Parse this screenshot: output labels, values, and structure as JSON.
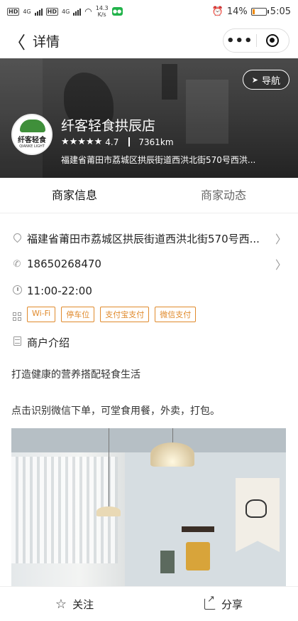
{
  "status_bar": {
    "network_1": "4G",
    "network_2": "4G",
    "speed_value": "14.3",
    "speed_unit": "K/s",
    "battery": "14%",
    "battery_level": 0.14,
    "time": "5:05"
  },
  "nav": {
    "title": "详情",
    "more": "•••"
  },
  "header": {
    "navigate_label": "导航",
    "logo_text": "纤客轻食",
    "logo_sub": "QIANKE LIGHT",
    "shop_name": "纤客轻食拱辰店",
    "stars": "★★★★★",
    "rating": "4.7",
    "distance": "7361km",
    "address": "福建省莆田市荔城区拱辰街道西洪北街570号西洪..."
  },
  "tabs": [
    {
      "label": "商家信息",
      "active": true
    },
    {
      "label": "商家动态",
      "active": false
    }
  ],
  "info": {
    "address": "福建省莆田市荔城区拱辰街道西洪北街570号西...",
    "phone": "18650268470",
    "hours": "11:00-22:00",
    "facilities": [
      "Wi-Fi",
      "停车位",
      "支付宝支付",
      "微信支付"
    ],
    "intro_title": "商户介绍",
    "intro_text_1": "打造健康的营养搭配轻食生活",
    "intro_text_2": "点击识别微信下单，可堂食用餐，外卖，打包。"
  },
  "bottom": {
    "follow": "关注",
    "share": "分享"
  },
  "colors": {
    "accent_tag": "#e08a2c",
    "battery": "#f08a00"
  }
}
